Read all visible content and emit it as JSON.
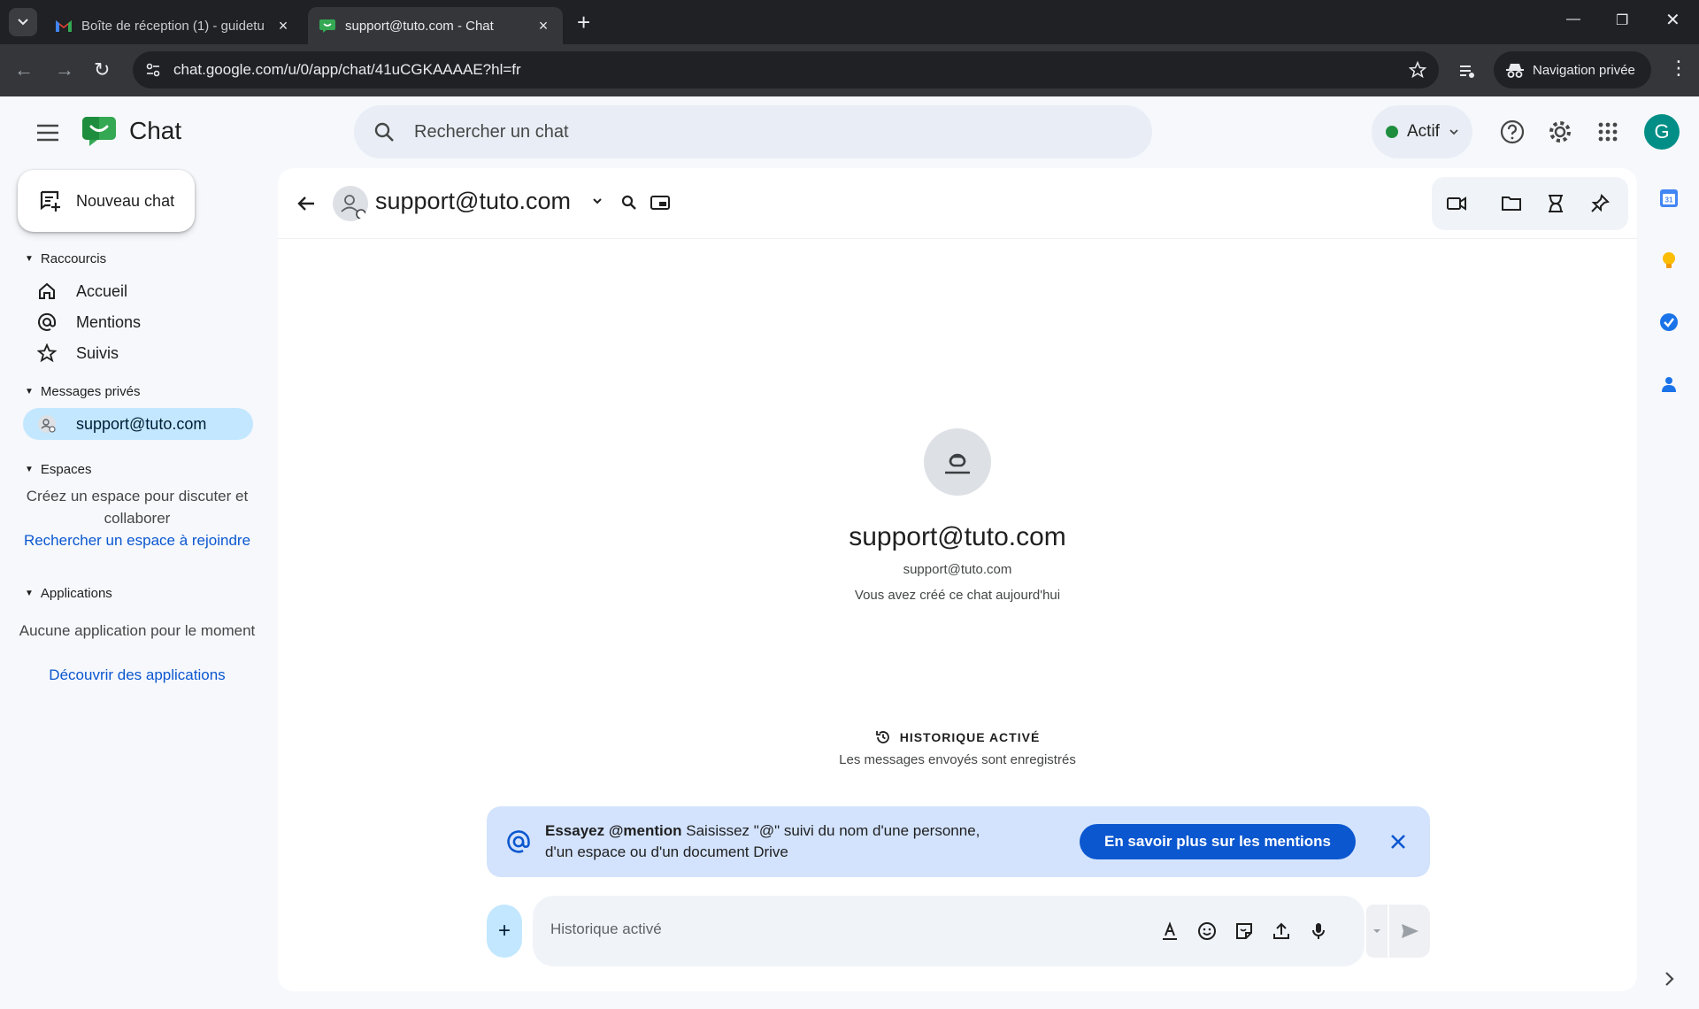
{
  "browser": {
    "tabs": [
      {
        "title": "Boîte de réception (1) - guidetu",
        "active": false
      },
      {
        "title": "support@tuto.com - Chat",
        "active": true
      }
    ],
    "url": "chat.google.com/u/0/app/chat/41uCGKAAAAE?hl=fr",
    "incognito_label": "Navigation privée"
  },
  "app": {
    "name": "Chat",
    "search_placeholder": "Rechercher un chat",
    "status": "Actif",
    "status_color": "#1e8e3e",
    "avatar_letter": "G",
    "avatar_color": "#008e86"
  },
  "sidebar": {
    "new_chat": "Nouveau chat",
    "shortcuts_header": "Raccourcis",
    "shortcuts": [
      {
        "label": "Accueil",
        "icon": "home-icon"
      },
      {
        "label": "Mentions",
        "icon": "at-icon"
      },
      {
        "label": "Suivis",
        "icon": "star-icon"
      }
    ],
    "dm_header": "Messages privés",
    "dms": [
      {
        "label": "support@tuto.com",
        "active": true
      }
    ],
    "spaces_header": "Espaces",
    "spaces_note": "Créez un espace pour discuter et collaborer",
    "spaces_link": "Rechercher un espace à rejoindre",
    "apps_header": "Applications",
    "apps_note": "Aucune application pour le moment",
    "apps_link": "Découvrir des applications"
  },
  "conversation": {
    "title": "support@tuto.com",
    "intro_name": "support@tuto.com",
    "intro_email": "support@tuto.com",
    "intro_note": "Vous avez créé ce chat aujourd'hui",
    "history_title": "HISTORIQUE ACTIVÉ",
    "history_sub": "Les messages envoyés sont enregistrés",
    "banner": {
      "bold": "Essayez @mention",
      "text": " Saisissez \"@\" suivi du nom d'une personne, d'un espace ou d'un document Drive",
      "button": "En savoir plus sur les mentions"
    },
    "composer_placeholder": "Historique activé"
  },
  "colors": {
    "accent": "#0b57d0",
    "active_item": "#c2e7ff",
    "banner_bg": "#d3e3fd"
  }
}
